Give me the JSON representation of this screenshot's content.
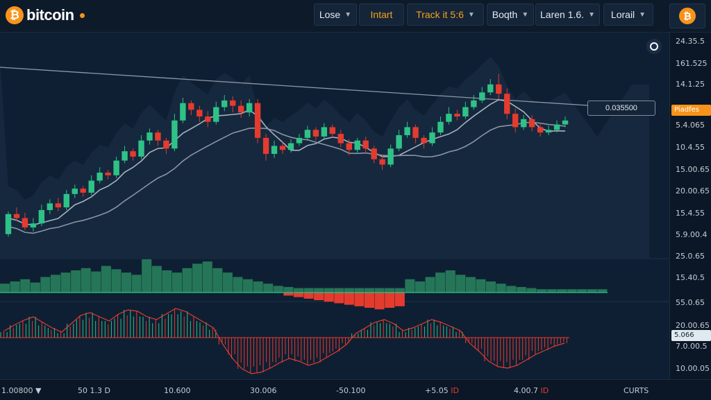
{
  "logo": {
    "text": "bitcoin",
    "coin_glyph": "₿"
  },
  "toolbar": {
    "buttons": [
      {
        "label": "Lose",
        "caret": true
      },
      {
        "label": "Intart",
        "caret": false,
        "accent": true
      },
      {
        "label": "Track it 5:6",
        "caret": true,
        "accent": true
      },
      {
        "label": "Boqth",
        "caret": true
      },
      {
        "label": "Laren 1.6.",
        "caret": true
      },
      {
        "label": "Lorail",
        "caret": true
      }
    ],
    "coin_button_glyph": "₿"
  },
  "price_axis": [
    "24.35.5",
    "161.525",
    "14.1.25",
    "5.4.065",
    "10.4.55",
    "15.00.65",
    "20.00.65",
    "15.4.55",
    "5.9.00.4",
    "25.0.65",
    "15.40.5",
    "55.0.65",
    "20.00.65",
    "7.0.00.5",
    "10.00.05"
  ],
  "tags": {
    "current_price": "Piadfes",
    "oscillator": "5.066"
  },
  "flag_label": "0.035500",
  "bottom": {
    "labels": [
      {
        "text": "1.00800 ▼",
        "red": ""
      },
      {
        "text": "50 1.3 D",
        "red": ""
      },
      {
        "text": "10.600",
        "red": ""
      },
      {
        "text": "30.006",
        "red": ""
      },
      {
        "text": "-50.100",
        "red": ""
      },
      {
        "text": "+5.05 ",
        "red": "ID"
      },
      {
        "text": "4.00.7 ",
        "red": "ID"
      },
      {
        "text": "CURTS",
        "red": ""
      }
    ]
  },
  "colors": {
    "up": "#2fc287",
    "down": "#e53b2f",
    "accent": "#f7931a",
    "background": "#0f1f33"
  },
  "chart_data": {
    "type": "candlestick",
    "candles": [
      [
        40,
        55,
        38,
        57
      ],
      [
        55,
        52,
        50,
        60
      ],
      [
        52,
        45,
        43,
        56
      ],
      [
        45,
        48,
        42,
        52
      ],
      [
        48,
        58,
        46,
        62
      ],
      [
        58,
        63,
        55,
        66
      ],
      [
        63,
        60,
        57,
        67
      ],
      [
        60,
        70,
        58,
        73
      ],
      [
        70,
        74,
        67,
        77
      ],
      [
        74,
        71,
        68,
        76
      ],
      [
        71,
        80,
        69,
        84
      ],
      [
        80,
        86,
        78,
        90
      ],
      [
        86,
        84,
        81,
        88
      ],
      [
        84,
        95,
        82,
        98
      ],
      [
        95,
        102,
        93,
        106
      ],
      [
        102,
        98,
        95,
        104
      ],
      [
        98,
        110,
        96,
        114
      ],
      [
        110,
        116,
        107,
        119
      ],
      [
        116,
        110,
        106,
        118
      ],
      [
        110,
        104,
        100,
        112
      ],
      [
        104,
        125,
        102,
        130
      ],
      [
        125,
        138,
        123,
        142
      ],
      [
        138,
        133,
        129,
        140
      ],
      [
        133,
        128,
        124,
        136
      ],
      [
        128,
        124,
        120,
        132
      ],
      [
        124,
        135,
        122,
        139
      ],
      [
        135,
        140,
        132,
        144
      ],
      [
        140,
        136,
        131,
        143
      ],
      [
        136,
        131,
        127,
        140
      ],
      [
        131,
        138,
        128,
        141
      ],
      [
        138,
        112,
        108,
        141
      ],
      [
        112,
        100,
        95,
        115
      ],
      [
        100,
        106,
        97,
        110
      ],
      [
        106,
        103,
        100,
        109
      ],
      [
        103,
        108,
        101,
        111
      ],
      [
        108,
        112,
        106,
        115
      ],
      [
        112,
        118,
        110,
        121
      ],
      [
        118,
        113,
        110,
        120
      ],
      [
        113,
        120,
        111,
        123
      ],
      [
        120,
        115,
        112,
        122
      ],
      [
        115,
        108,
        105,
        118
      ],
      [
        108,
        103,
        99,
        111
      ],
      [
        103,
        110,
        101,
        112
      ],
      [
        110,
        104,
        100,
        113
      ],
      [
        104,
        96,
        93,
        106
      ],
      [
        96,
        92,
        88,
        99
      ],
      [
        92,
        104,
        90,
        107
      ],
      [
        104,
        114,
        102,
        118
      ],
      [
        114,
        120,
        112,
        124
      ],
      [
        120,
        112,
        108,
        122
      ],
      [
        112,
        108,
        104,
        114
      ],
      [
        108,
        116,
        106,
        120
      ],
      [
        116,
        124,
        114,
        128
      ],
      [
        124,
        130,
        122,
        135
      ],
      [
        130,
        128,
        125,
        133
      ],
      [
        128,
        135,
        126,
        139
      ],
      [
        135,
        140,
        133,
        144
      ],
      [
        140,
        146,
        138,
        150
      ],
      [
        146,
        152,
        144,
        156
      ],
      [
        152,
        145,
        141,
        160
      ],
      [
        145,
        130,
        126,
        149
      ],
      [
        130,
        120,
        116,
        134
      ],
      [
        120,
        126,
        118,
        129
      ],
      [
        126,
        120,
        117,
        129
      ],
      [
        120,
        116,
        113,
        123
      ],
      [
        116,
        118,
        114,
        121
      ],
      [
        118,
        122,
        116,
        125
      ],
      [
        122,
        125,
        120,
        128
      ]
    ],
    "ylim": [
      30,
      170
    ],
    "volume": {
      "positive": [
        8,
        10,
        12,
        9,
        14,
        16,
        18,
        20,
        22,
        19,
        24,
        21,
        18,
        16,
        30,
        24,
        20,
        18,
        22,
        26,
        28,
        22,
        18,
        14,
        12,
        10,
        8,
        6,
        5,
        4,
        4,
        4,
        4,
        4,
        4,
        4,
        4,
        4,
        4,
        4,
        12,
        10,
        14,
        18,
        20,
        16,
        14,
        12,
        10,
        8,
        6,
        5,
        4,
        3,
        3,
        3,
        3,
        3,
        3,
        3
      ],
      "negative": [
        0,
        0,
        0,
        0,
        0,
        0,
        0,
        0,
        0,
        0,
        0,
        0,
        0,
        0,
        0,
        0,
        0,
        0,
        0,
        0,
        0,
        0,
        0,
        0,
        0,
        0,
        0,
        0,
        4,
        6,
        8,
        10,
        12,
        14,
        16,
        18,
        20,
        22,
        20,
        18,
        0,
        0,
        0,
        0,
        0,
        0,
        0,
        0,
        0,
        0,
        0,
        0,
        0,
        0,
        0,
        0,
        0,
        0,
        0,
        0
      ]
    },
    "oscillator": [
      10,
      18,
      25,
      30,
      22,
      14,
      8,
      20,
      32,
      36,
      30,
      24,
      34,
      40,
      38,
      30,
      26,
      34,
      42,
      38,
      30,
      22,
      14,
      -10,
      -30,
      -45,
      -52,
      -50,
      -44,
      -36,
      -30,
      -34,
      -40,
      -36,
      -28,
      -20,
      -10,
      6,
      14,
      22,
      26,
      20,
      10,
      14,
      20,
      26,
      22,
      16,
      10,
      -8,
      -20,
      -34,
      -42,
      -44,
      -40,
      -32,
      -24,
      -18,
      -12,
      -8
    ]
  }
}
